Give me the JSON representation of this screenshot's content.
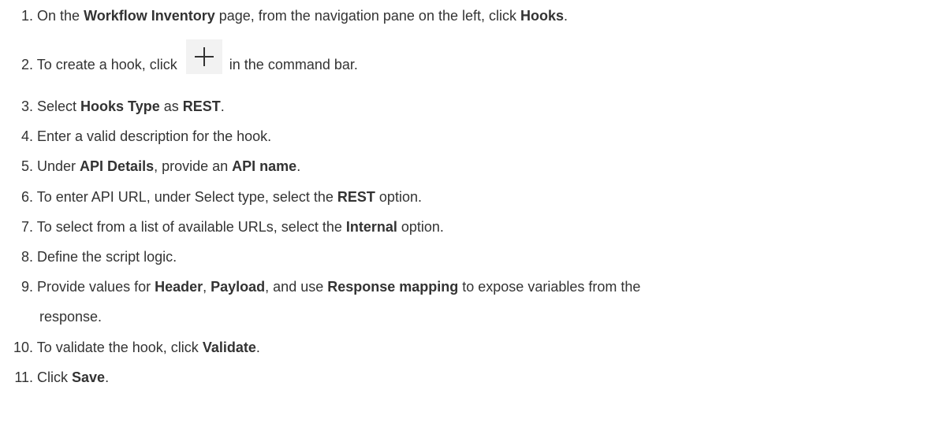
{
  "steps": [
    {
      "number": "1.",
      "parts": [
        "On the ",
        "Workflow Inventory",
        " page, from the navigation pane on the left, click ",
        "Hooks",
        "."
      ]
    },
    {
      "number": "2.",
      "parts": [
        "To create a hook, click ",
        " in the command bar."
      ],
      "icon": "plus-icon"
    },
    {
      "number": "3.",
      "parts": [
        "Select ",
        "Hooks Type",
        " as ",
        "REST",
        "."
      ]
    },
    {
      "number": "4.",
      "parts": [
        "Enter a valid description for the hook."
      ]
    },
    {
      "number": "5.",
      "parts": [
        "Under ",
        "API Details",
        ", provide an ",
        "API name",
        "."
      ]
    },
    {
      "number": "6.",
      "parts": [
        "To enter API URL, under Select type, select the ",
        "REST",
        " option."
      ]
    },
    {
      "number": "7.",
      "parts": [
        "To select from a list of available URLs, select the ",
        "Internal",
        " option."
      ]
    },
    {
      "number": "8.",
      "parts": [
        "Define the script logic."
      ]
    },
    {
      "number": "9.",
      "parts": [
        "Provide values for ",
        "Header",
        ", ",
        "Payload",
        ", and use ",
        "Response mapping",
        " to expose variables from the"
      ],
      "continuation": "response."
    },
    {
      "number": "10.",
      "parts": [
        "To validate the hook, click ",
        "Validate",
        "."
      ]
    },
    {
      "number": "11.",
      "parts": [
        "Click ",
        "Save",
        "."
      ]
    }
  ]
}
